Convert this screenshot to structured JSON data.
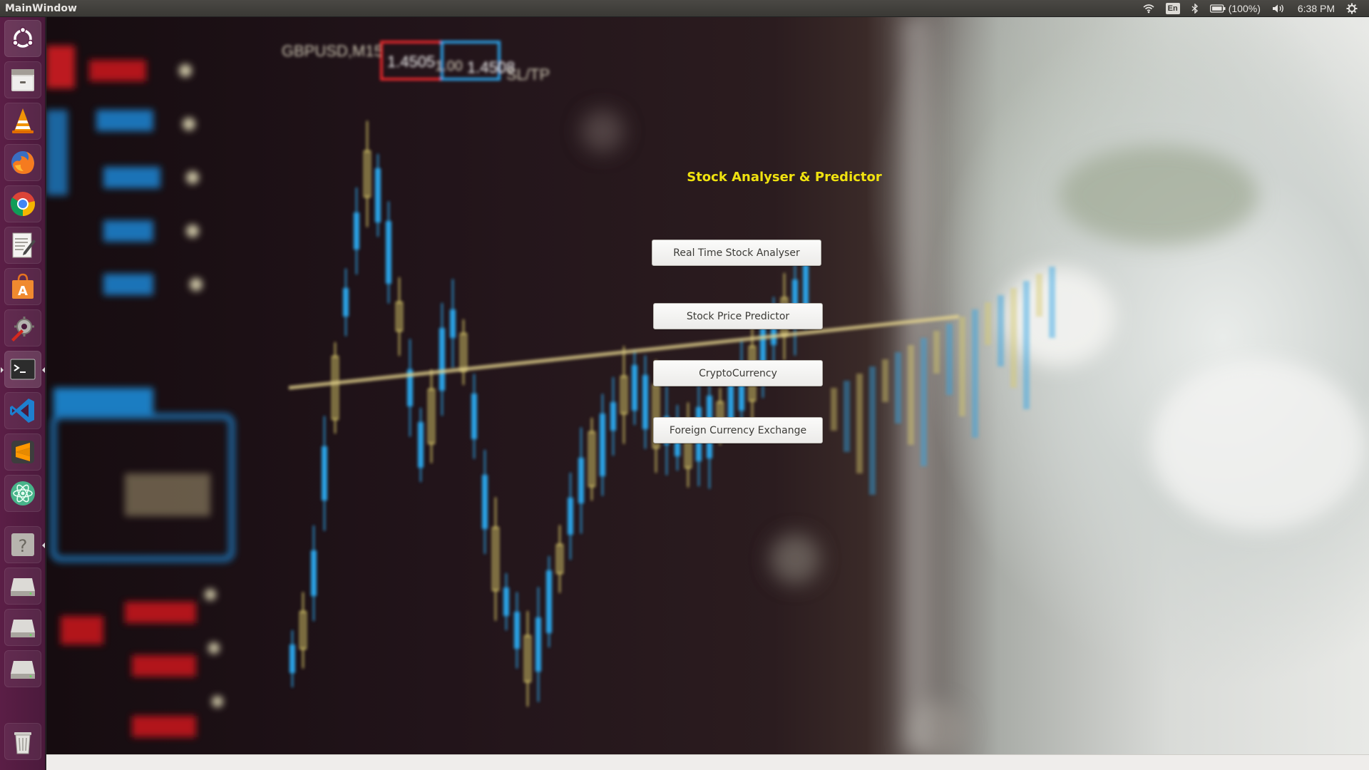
{
  "window": {
    "title": "MainWindow"
  },
  "indicators": {
    "wifi_icon": "wifi-icon",
    "keyboard_layout": "En",
    "bluetooth_icon": "bluetooth-icon",
    "battery": "(100%)",
    "volume_icon": "volume-icon",
    "clock": "6:38 PM",
    "settings_icon": "gear-icon"
  },
  "launcher": [
    {
      "id": "ubuntu-dash",
      "icon": "ubuntu-logo-icon"
    },
    {
      "id": "files",
      "icon": "file-cabinet-icon"
    },
    {
      "id": "vlc",
      "icon": "traffic-cone-icon"
    },
    {
      "id": "firefox",
      "icon": "firefox-icon"
    },
    {
      "id": "chrome",
      "icon": "chrome-icon"
    },
    {
      "id": "text-editor",
      "icon": "text-editor-icon"
    },
    {
      "id": "software-center",
      "icon": "shopping-bag-icon"
    },
    {
      "id": "system-settings",
      "icon": "wrench-gear-icon"
    },
    {
      "id": "terminal",
      "icon": "terminal-icon"
    },
    {
      "id": "vscode",
      "icon": "vscode-icon"
    },
    {
      "id": "sublime",
      "icon": "sublime-icon"
    },
    {
      "id": "atom",
      "icon": "atom-icon"
    },
    {
      "id": "unknown-app",
      "icon": "question-mark-icon"
    },
    {
      "id": "drive-1",
      "icon": "drive-icon"
    },
    {
      "id": "drive-2",
      "icon": "drive-icon"
    },
    {
      "id": "drive-3",
      "icon": "drive-icon"
    },
    {
      "id": "trash",
      "icon": "trash-icon"
    }
  ],
  "app": {
    "title": "Stock Analyser & Predictor",
    "buttons": {
      "real_time": "Real Time Stock Analyser",
      "predictor": "Stock Price Predictor",
      "crypto": "CryptoCurrency",
      "forex": "Foreign Currency Exchange"
    }
  },
  "background_overlay": {
    "pair": "GBPUSD,M15",
    "bid": "1.4505",
    "lot": "1.00",
    "ask": "1.4508",
    "sltp": "SL/TP"
  },
  "colors": {
    "title": "#f0e20f",
    "launcher": "#5b1e46",
    "candle_blue": "#2aa3e6",
    "candle_yellow": "#d9c96a"
  }
}
